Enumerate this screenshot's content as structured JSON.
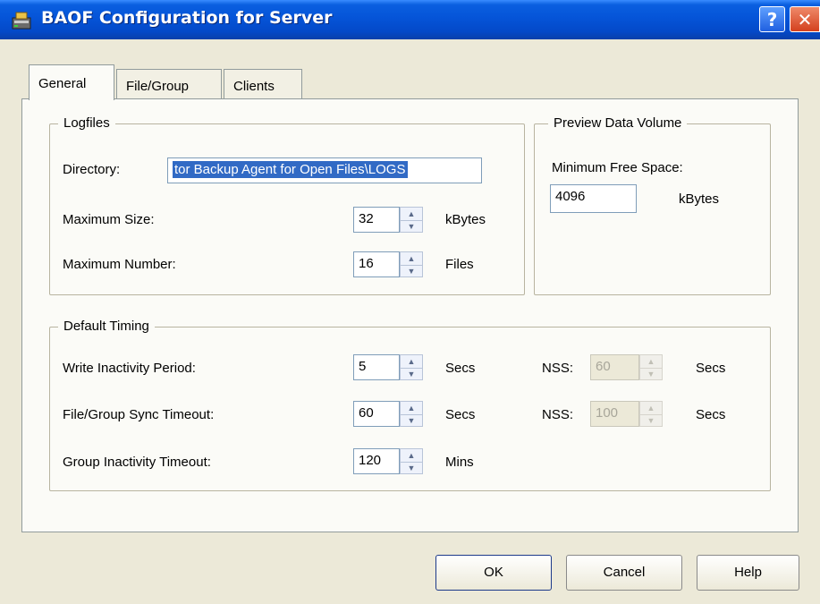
{
  "window": {
    "title": "BAOF Configuration for Server"
  },
  "titlebar_buttons": {
    "help": "?",
    "close": "✕"
  },
  "tabs": [
    {
      "label": "General"
    },
    {
      "label": "File/Group"
    },
    {
      "label": "Clients"
    }
  ],
  "logfiles": {
    "legend": "Logfiles",
    "directory_label": "Directory:",
    "directory_value": "tor Backup Agent for Open Files\\LOGS",
    "max_size_label": "Maximum Size:",
    "max_size_value": "32",
    "max_size_unit": "kBytes",
    "max_number_label": "Maximum Number:",
    "max_number_value": "16",
    "max_number_unit": "Files"
  },
  "preview": {
    "legend": "Preview Data Volume",
    "min_free_label": "Minimum Free Space:",
    "min_free_value": "4096",
    "min_free_unit": "kBytes"
  },
  "timing": {
    "legend": "Default Timing",
    "write_label": "Write Inactivity Period:",
    "write_value": "5",
    "write_unit": "Secs",
    "write_nss_label": "NSS:",
    "write_nss_value": "60",
    "write_nss_unit": "Secs",
    "sync_label": "File/Group Sync Timeout:",
    "sync_value": "60",
    "sync_unit": "Secs",
    "sync_nss_label": "NSS:",
    "sync_nss_value": "100",
    "sync_nss_unit": "Secs",
    "group_label": "Group Inactivity Timeout:",
    "group_value": "120",
    "group_unit": "Mins"
  },
  "buttons": {
    "ok": "OK",
    "cancel": "Cancel",
    "help": "Help"
  },
  "icons": {
    "spin_up": "▲",
    "spin_down": "▼"
  },
  "colors": {
    "titlebar": "#0554d8",
    "selection": "#316ac5",
    "dialog_bg": "#ece9d8"
  }
}
